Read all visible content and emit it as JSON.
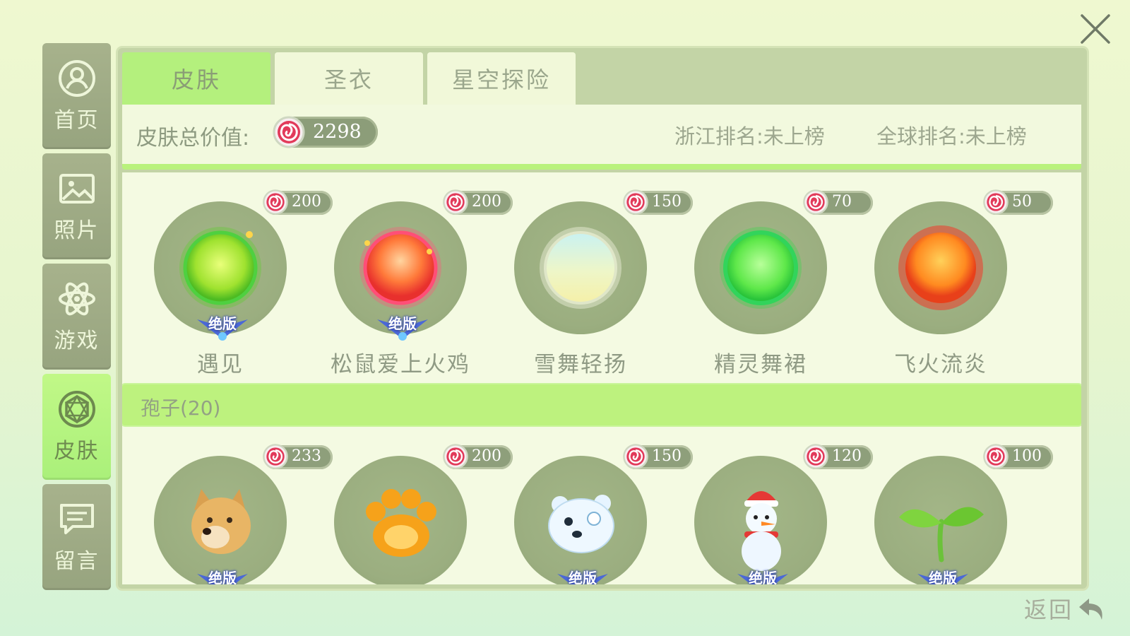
{
  "sidebar": {
    "items": [
      {
        "label": "首页",
        "icon": "user-icon",
        "active": false
      },
      {
        "label": "照片",
        "icon": "photo-icon",
        "active": false
      },
      {
        "label": "游戏",
        "icon": "atom-icon",
        "active": false
      },
      {
        "label": "皮肤",
        "icon": "gem-icon",
        "active": true
      },
      {
        "label": "留言",
        "icon": "message-icon",
        "active": false
      }
    ]
  },
  "tabs": [
    {
      "label": "皮肤",
      "active": true
    },
    {
      "label": "圣衣",
      "active": false
    },
    {
      "label": "星空探险",
      "active": false
    }
  ],
  "summary": {
    "total_label": "皮肤总价值:",
    "total_value": "2298",
    "rank_province": "浙江排名:未上榜",
    "rank_global": "全球排名:未上榜"
  },
  "skins": [
    {
      "name": "遇见",
      "price": "200",
      "badge": "绝版",
      "art": "green-orb"
    },
    {
      "name": "松鼠爱上火鸡",
      "price": "200",
      "badge": "绝版",
      "art": "fire-orb"
    },
    {
      "name": "雪舞轻扬",
      "price": "150",
      "badge": "",
      "art": "snow-orb"
    },
    {
      "name": "精灵舞裙",
      "price": "70",
      "badge": "",
      "art": "leaf-orb"
    },
    {
      "name": "飞火流炎",
      "price": "50",
      "badge": "",
      "art": "sun-orb"
    }
  ],
  "section": {
    "title": "孢子(20)"
  },
  "spores": [
    {
      "price": "233",
      "badge": "绝版",
      "art": "doge-icon"
    },
    {
      "price": "200",
      "badge": "",
      "art": "paw-icon"
    },
    {
      "price": "150",
      "badge": "绝版",
      "art": "polar-bear-icon"
    },
    {
      "price": "120",
      "badge": "绝版",
      "art": "snowman-icon"
    },
    {
      "price": "100",
      "badge": "绝版",
      "art": "sprout-icon"
    }
  ],
  "back": {
    "label": "返回"
  },
  "colors": {
    "accent": "#b4f07d",
    "panel": "#c3d4a6",
    "coin": "#e23a5a"
  }
}
